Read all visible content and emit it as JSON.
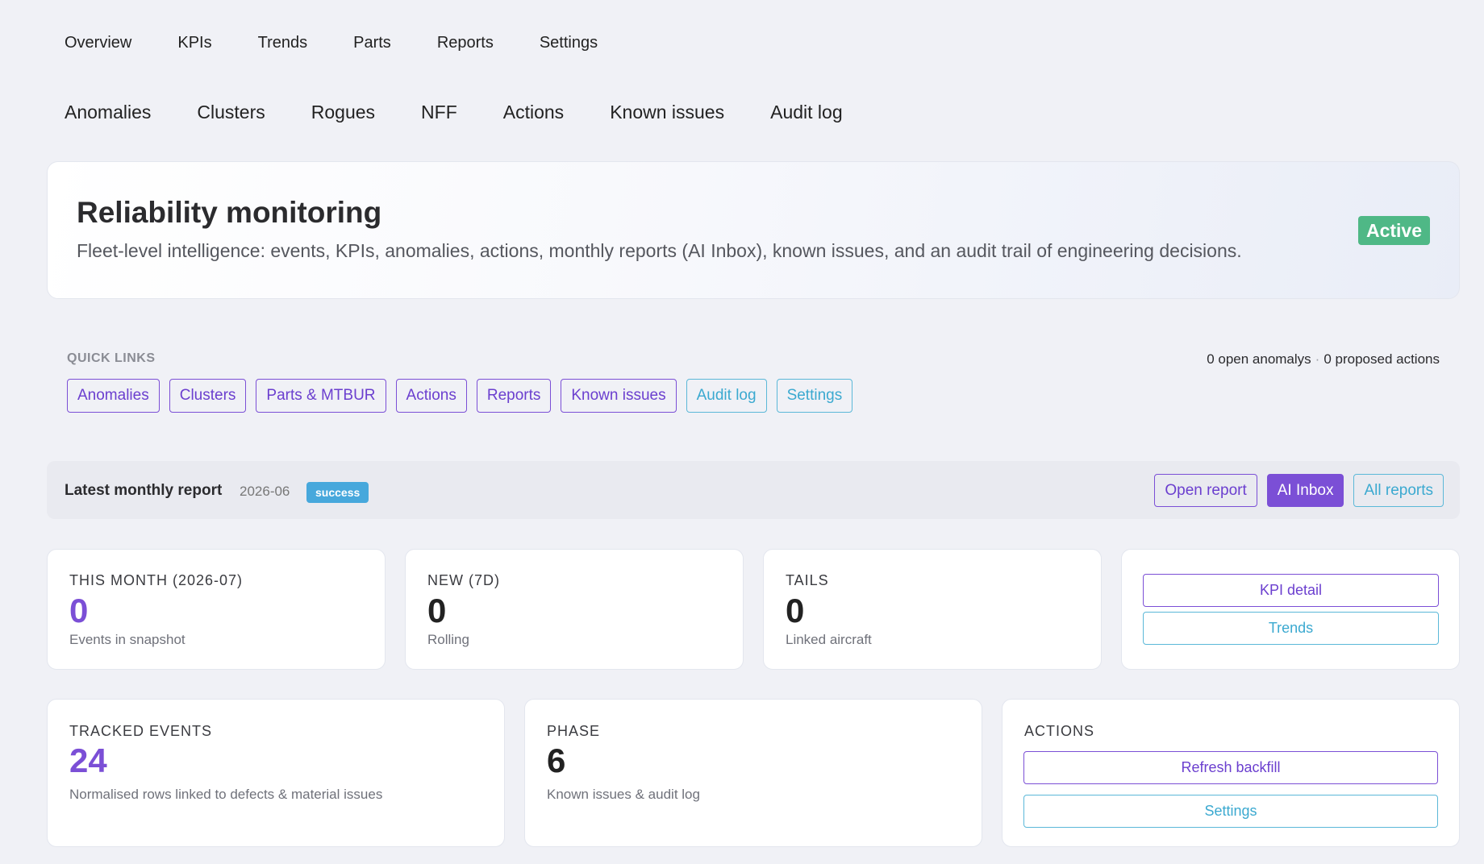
{
  "nav_primary": [
    "Overview",
    "KPIs",
    "Trends",
    "Parts",
    "Reports",
    "Settings"
  ],
  "nav_secondary": [
    "Anomalies",
    "Clusters",
    "Rogues",
    "NFF",
    "Actions",
    "Known issues",
    "Audit log"
  ],
  "hero": {
    "title": "Reliability monitoring",
    "description": "Fleet-level intelligence: events, KPIs, anomalies, actions, monthly reports (AI Inbox), known issues, and an audit trail of engineering decisions.",
    "status": "Active",
    "status_color": "#4fb886"
  },
  "quick_links": {
    "title": "QUICK LINKS",
    "open_anomalies": "0 open anomalys",
    "separator": "·",
    "proposed_actions": "0 proposed actions",
    "links": [
      "Anomalies",
      "Clusters",
      "Parts & MTBUR",
      "Actions",
      "Reports",
      "Known issues",
      "Audit log",
      "Settings"
    ]
  },
  "latest_report": {
    "title": "Latest monthly report",
    "period": "2026-06",
    "status": "success",
    "buttons": [
      "Open report",
      "AI Inbox",
      "All reports"
    ]
  },
  "stats": {
    "this_month": {
      "label": "THIS MONTH (2026-07)",
      "value": "0",
      "sub": "Events in snapshot"
    },
    "new_7d": {
      "label": "NEW (7D)",
      "value": "0",
      "sub": "Rolling"
    },
    "tails": {
      "label": "TAILS",
      "value": "0",
      "sub": "Linked aircraft"
    },
    "links": {
      "kpi_detail": "KPI detail",
      "trends": "Trends"
    },
    "tracked_events": {
      "label": "TRACKED EVENTS",
      "value": "24",
      "sub": "Normalised rows linked to defects & material issues"
    },
    "phase": {
      "label": "PHASE",
      "value": "6",
      "sub": "Known issues & audit log"
    },
    "actions": {
      "label": "ACTIONS",
      "refresh": "Refresh backfill",
      "settings": "Settings"
    }
  },
  "colors": {
    "accent_purple": "#7b4fd6",
    "accent_teal": "#3ba9d0",
    "background": "#f0f1f6"
  }
}
